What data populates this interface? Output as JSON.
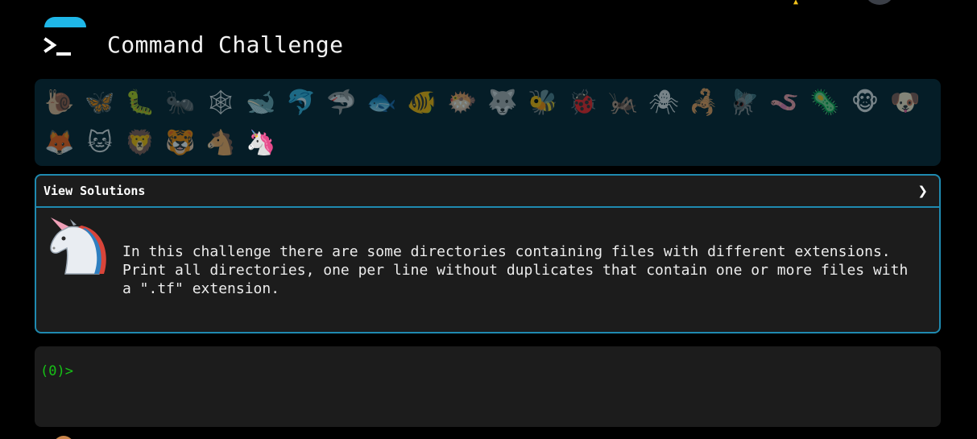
{
  "header": {
    "title": "Command Challenge",
    "logo_icon": "terminal-icon",
    "accent_color": "#1fb7e8"
  },
  "animals": [
    {
      "name": "snail",
      "glyph": "🐌"
    },
    {
      "name": "butterfly",
      "glyph": "🦋"
    },
    {
      "name": "caterpillar",
      "glyph": "🐛"
    },
    {
      "name": "ant",
      "glyph": "🐜"
    },
    {
      "name": "spider-web",
      "glyph": "🕸"
    },
    {
      "name": "whale",
      "glyph": "🐋"
    },
    {
      "name": "dolphin",
      "glyph": "🐬"
    },
    {
      "name": "shark",
      "glyph": "🦈"
    },
    {
      "name": "fish",
      "glyph": "🐟"
    },
    {
      "name": "tropical-fish",
      "glyph": "🐠"
    },
    {
      "name": "blowfish",
      "glyph": "🐡"
    },
    {
      "name": "wolf",
      "glyph": "🐺"
    },
    {
      "name": "bee",
      "glyph": "🐝"
    },
    {
      "name": "ladybug",
      "glyph": "🐞"
    },
    {
      "name": "cricket",
      "glyph": "🦗"
    },
    {
      "name": "spider",
      "glyph": "🕷"
    },
    {
      "name": "scorpion",
      "glyph": "🦂"
    },
    {
      "name": "fly",
      "glyph": "🪰"
    },
    {
      "name": "worm",
      "glyph": "🪱"
    },
    {
      "name": "microbe",
      "glyph": "🦠"
    },
    {
      "name": "monkey",
      "glyph": "🐵"
    },
    {
      "name": "dog",
      "glyph": "🐶"
    },
    {
      "name": "fox",
      "glyph": "🦊"
    },
    {
      "name": "cat",
      "glyph": "🐱"
    },
    {
      "name": "lion",
      "glyph": "🦁"
    },
    {
      "name": "tiger",
      "glyph": "🐯"
    },
    {
      "name": "horse",
      "glyph": "🐴"
    },
    {
      "name": "unicorn",
      "glyph": "🦄",
      "active": true
    }
  ],
  "solutions_panel": {
    "header_label": "View Solutions",
    "chevron": "❯",
    "challenge_text": "In this challenge there are some directories containing files with different extensions. Print all directories, one per line without duplicates that contain one or more files with a \".tf\" extension.",
    "panel_border_color": "#1f8ab0"
  },
  "terminal": {
    "prompt": "(0)>",
    "input_value": "",
    "prompt_color": "#16c216"
  }
}
